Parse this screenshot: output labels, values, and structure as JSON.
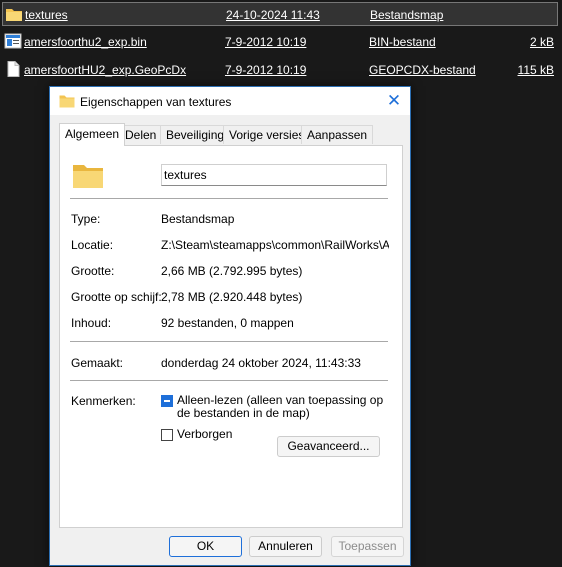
{
  "file_list": {
    "rows": [
      {
        "name": "textures",
        "date": "24-10-2024 11:43",
        "type": "Bestandsmap",
        "size": "",
        "icon": "folder-icon"
      },
      {
        "name": "amersfoorthu2_exp.bin",
        "date": "7-9-2012 10:19",
        "type": "BIN-bestand",
        "size": "2 kB",
        "icon": "bin-file-icon"
      },
      {
        "name": "amersfoortHU2_exp.GeoPcDx",
        "date": "7-9-2012 10:19",
        "type": "GEOPCDX-bestand",
        "size": "115 kB",
        "icon": "document-icon"
      }
    ]
  },
  "dialog": {
    "title": "Eigenschappen van textures",
    "tabs": [
      "Algemeen",
      "Delen",
      "Beveiliging",
      "Vorige versies",
      "Aanpassen"
    ],
    "active_tab": "Algemeen",
    "name_value": "textures",
    "fields": {
      "type_label": "Type:",
      "type_value": "Bestandsmap",
      "location_label": "Locatie:",
      "location_value": "Z:\\Steam\\steamapps\\common\\RailWorks\\Assets",
      "size_label": "Grootte:",
      "size_value": "2,66 MB (2.792.995 bytes)",
      "disk_size_label": "Grootte op schijf:",
      "disk_size_value": "2,78 MB (2.920.448 bytes)",
      "contents_label": "Inhoud:",
      "contents_value": "92 bestanden, 0 mappen",
      "created_label": "Gemaakt:",
      "created_value": "donderdag 24 oktober 2024, 11:43:33",
      "attributes_label": "Kenmerken:"
    },
    "attributes": {
      "readonly_label": "Alleen-lezen (alleen van toepassing op de bestanden in de map)",
      "readonly_state": "indeterminate",
      "hidden_label": "Verborgen",
      "hidden_checked": false,
      "advanced_button": "Geavanceerd..."
    },
    "buttons": {
      "ok": "OK",
      "cancel": "Annuleren",
      "apply": "Toepassen"
    },
    "colors": {
      "accent": "#1e6fd9",
      "folder": "#f3c452"
    }
  }
}
